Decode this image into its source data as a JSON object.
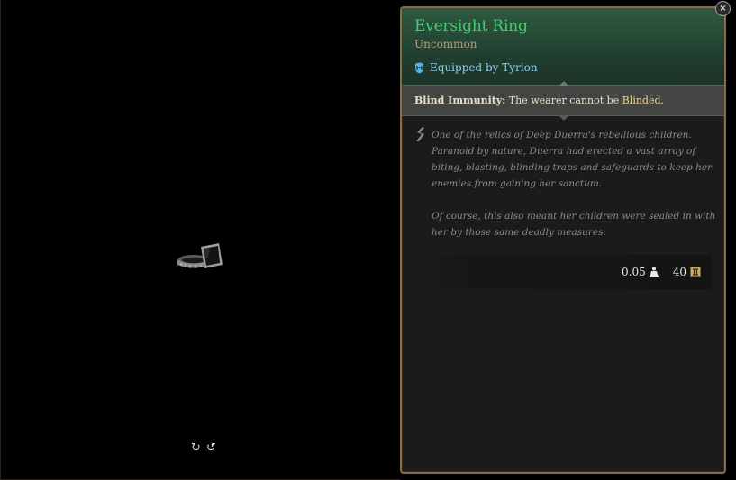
{
  "preview": {
    "rotate_left_icon": "rotate-left-icon",
    "rotate_right_icon": "rotate-right-icon",
    "rotate_left_glyph": "↻",
    "rotate_right_glyph": "↺"
  },
  "tooltip": {
    "close_glyph": "×",
    "item_name": "Eversight Ring",
    "rarity": "Uncommon",
    "equipped_by": "Equipped by Tyrion",
    "ability": {
      "name": "Blind Immunity:",
      "text_before": " The wearer cannot be ",
      "keyword": "Blinded",
      "text_after": "."
    },
    "lore": [
      "One of the relics of Deep Duerra's rebellious children. Paranoid by nature, Duerra had erected a vast array of biting, blasting, blinding traps and safeguards to keep her enemies from gaining her sanctum.",
      "Of course, this also meant her children were sealed in with her by those same deadly measures."
    ],
    "weight": "0.05",
    "value": "40"
  },
  "colors": {
    "rarity_green": "#3ecf6e",
    "header_bg": "#224233",
    "panel_border": "#8a6b43",
    "equipped_blue": "#8ed0f0",
    "keyword_gold": "#f0d68e"
  }
}
